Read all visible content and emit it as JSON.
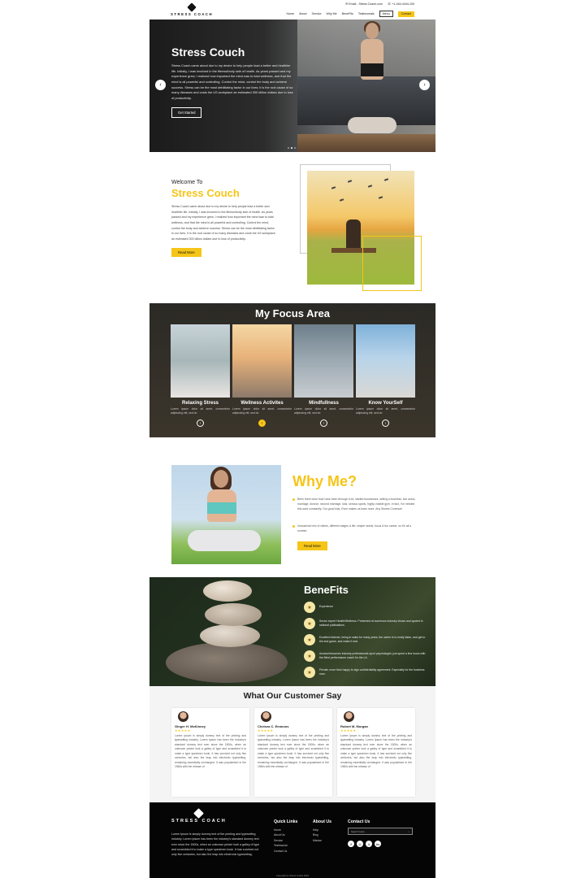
{
  "header": {
    "brand": "STRESS COACH",
    "email": "Email - Stress Coach.com",
    "phone": "+1-444-4444-100",
    "nav": [
      "Home",
      "About",
      "Service",
      "Why Me",
      "BeneFits",
      "Testimonials"
    ],
    "menu_label": "Menu",
    "contact_label": "Contact"
  },
  "hero": {
    "title": "Stress Couch",
    "body": "Stress Coach came about due to my desire to help people lead a better and healthier life. Initially, I was involved in the fitness/body side of health. As years passed and my experience grew, I realized how important the mind was to total wellness, and that the mind is all powerful and controlling. Control the mind, control the body and achieve success. Stress can be the most debilitating factor in our lives; it is the root cause of so many diseases and costs the US workplace an estimated 300 billion dollars due to loss of productivity.",
    "cta": "Get Started",
    "prev_icon": "chevron-left-icon",
    "next_icon": "chevron-right-icon"
  },
  "welcome": {
    "small": "Welcome To",
    "big": "Stress Couch",
    "body": "Stress Coach came about due to my desire to help people lead a better and healthier life. Initially, I was involved in the fitness/body side of health. As years passed and my experience grew, I realized how important the mind was to total wellness, and that the mind is all powerful and controlling. Control the mind, control the body and achieve success. Stress can be the most debilitating factor in our lives. It is the root cause of so many diseases and costs the US workplace an estimated 300 billion dollars due to loss of productivity.",
    "cta": "Read More"
  },
  "focus": {
    "title": "My Focus Area",
    "cards": [
      {
        "name": "Relaxing Stress",
        "desc": "Lorem ipsum dolor sit amet, consectetur adipiscing elit, sed do"
      },
      {
        "name": "Wellness Activites",
        "desc": "Lorem ipsum dolor sit amet, consectetur adipiscing elit, sed do"
      },
      {
        "name": "Mindfullness",
        "desc": "Lorem ipsum dolor sit amet, consectetur adipiscing elit, sed do"
      },
      {
        "name": "Know YourSelf",
        "desc": "Lorem ipsum dolor sit amet, consectetur adipiscing elit, sed do"
      }
    ]
  },
  "why": {
    "title": "Why Me?",
    "items": [
      "Been there done that: have been through a lot, started businesses, selling a business, two autos, marriage, divorce, second marriage, kids, serious sports, highly volatile gym. In fact, I've needed this work constantly. Our good kids. Even makes us learn more. Any Stories Common!",
      "Unmatched mix of clients, different stages & life, simple needs, focus & fun career, so it's all a number."
    ],
    "cta": "Read More"
  },
  "benefits": {
    "title": "BeneFits",
    "items": [
      "Experience",
      "Sector expert Health/Wellness. Presented at numerous industry shows and quoted in national publications.",
      "Excellent listener, being in sales for many years, the owner is to really listen, and get to the end game, and make it real.",
      "Access/resources industry professionals sport psychologist, just spent a few hours with the Mind performance coach for the LA.",
      "Private, more than happy to sign confidentiality agreement. Especially for the business man."
    ]
  },
  "testimonials": {
    "title": "What Our Customer Say",
    "stars": "★★★★★",
    "items": [
      {
        "name": "Ginger H. McKinney",
        "body": "Lorem Ipsum is simply dummy text of the printing and typesetting industry. Lorem Ipsum has been the industry's standard dummy text ever since the 1500s, when an unknown printer took a galley of type and scrambled it to make a type specimen book. It has survived not only five centuries, but also the leap into electronic typesetting, remaining essentially unchanged. It was popularised in the 1960s with the release of"
      },
      {
        "name": "Chelsea C. Emmons",
        "body": "Lorem Ipsum is simply dummy text of the printing and typesetting industry. Lorem Ipsum has been the industry's standard dummy text ever since the 1500s, when an unknown printer took a galley of type and scrambled it to make a type specimen book. It has survived not only five centuries, but also the leap into electronic typesetting, remaining essentially unchanged. It was popularised in the 1960s with the release of"
      },
      {
        "name": "Robert M. Morgan",
        "body": "Lorem Ipsum is simply dummy text of the printing and typesetting industry. Lorem Ipsum has been the industry's standard dummy text ever since the 1500s, when an unknown printer took a galley of type and scrambled it to make a type specimen book. It has survived not only five centuries, but also the leap into electronic typesetting, remaining essentially unchanged. It was popularised in the 1960s with the release of"
      }
    ]
  },
  "footer": {
    "brand": "STRESS COACH",
    "about": "Lorem Ipsum is simply dummy text of the printing and typesetting industry. Lorem Ipsum has been the industry's standard dummy text ever since the 1500s, when an unknown printer took a galley of type and scrambled it to make a type specimen book. It has survived not only five centuries, but also the leap into electronic typesetting.",
    "quick_links_title": "Quick Links",
    "quick_links": [
      "Home",
      "About Us",
      "Service",
      "Testimonial",
      "Contact Us"
    ],
    "about_title": "About Us",
    "about_links": [
      "Help",
      "Blog",
      "Mission"
    ],
    "contact_title": "Contact Us",
    "search_placeholder": "Search Here",
    "socials": [
      "f",
      "◎",
      "t",
      "in"
    ],
    "copyright": "Copyright by Stress Coach 2022"
  },
  "colors": {
    "accent": "#f5c518",
    "dark": "#050505"
  }
}
